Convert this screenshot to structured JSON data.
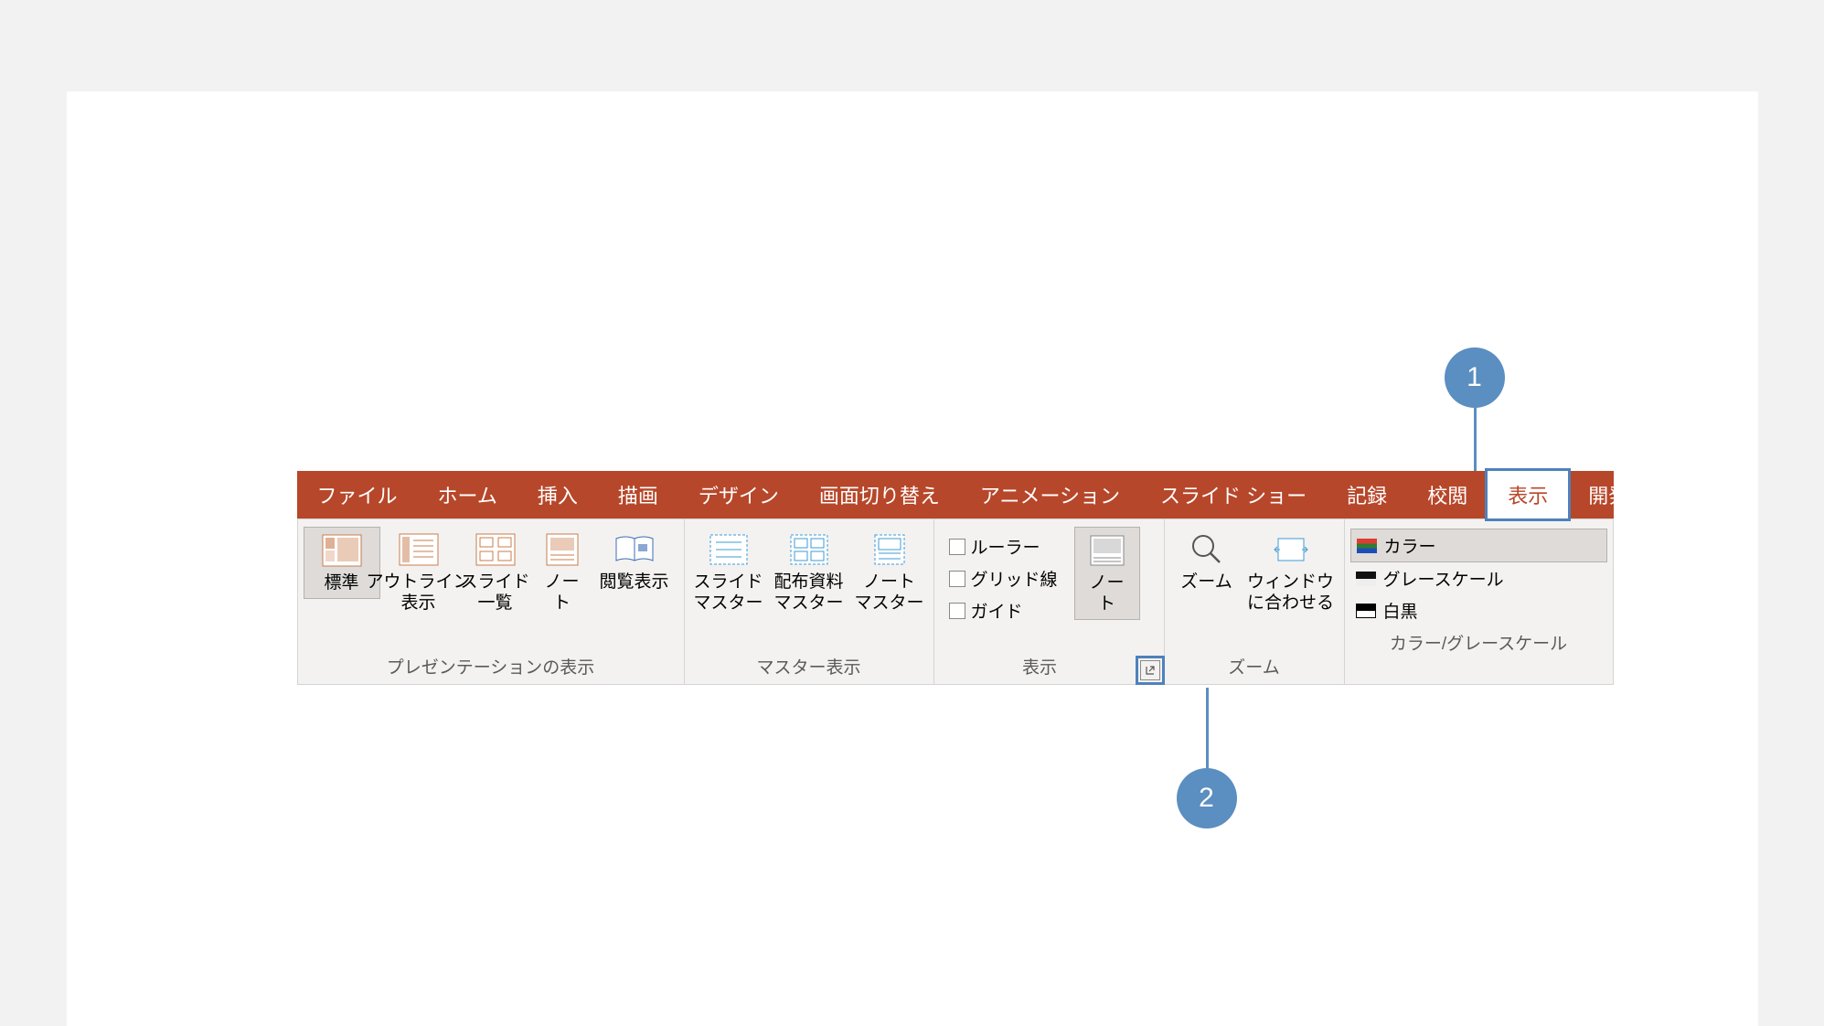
{
  "callouts": {
    "c1": "1",
    "c2": "2"
  },
  "tabs": {
    "file": "ファイル",
    "home": "ホーム",
    "insert": "挿入",
    "draw": "描画",
    "design": "デザイン",
    "transitions": "画面切り替え",
    "animations": "アニメーション",
    "slideshow": "スライド ショー",
    "record": "記録",
    "review": "校閲",
    "view": "表示",
    "developer": "開発"
  },
  "groups": {
    "presentation_views": {
      "label": "プレゼンテーションの表示",
      "normal": "標準",
      "outline": "アウトライン\n表示",
      "sorter": "スライド\n一覧",
      "notes": "ノー\nト",
      "reading": "閲覧表示"
    },
    "master_views": {
      "label": "マスター表示",
      "slide_master": "スライド\nマスター",
      "handout_master": "配布資料\nマスター",
      "notes_master": "ノート\nマスター"
    },
    "show": {
      "label": "表示",
      "ruler": "ルーラー",
      "gridlines": "グリッド線",
      "guides": "ガイド",
      "notes_btn": "ノー\nト"
    },
    "zoom": {
      "label": "ズーム",
      "zoom": "ズーム",
      "fit": "ウィンドウ\nに合わせる"
    },
    "color": {
      "label": "カラー/グレースケール",
      "color": "カラー",
      "grayscale": "グレースケール",
      "bw": "白黒"
    }
  }
}
